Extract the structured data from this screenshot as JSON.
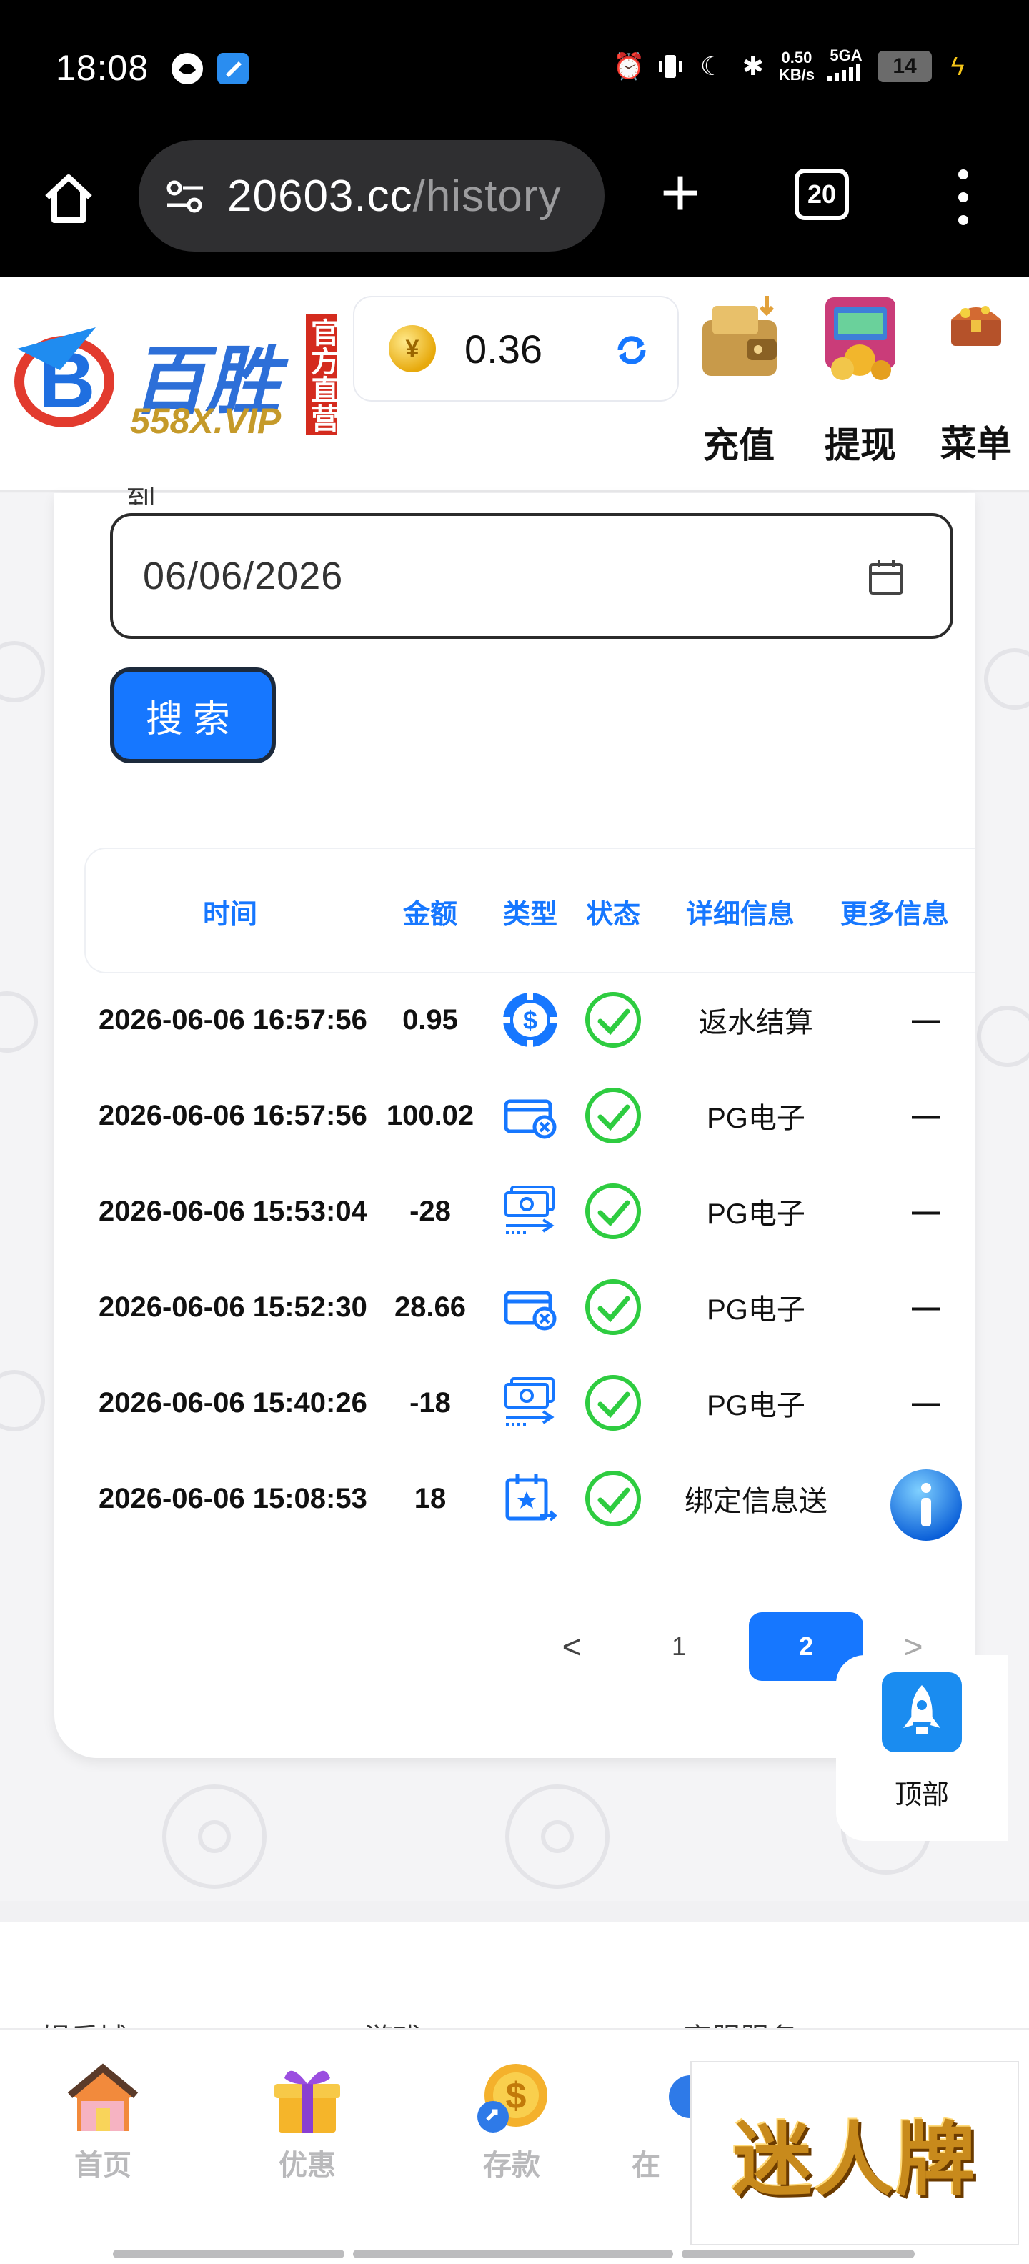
{
  "status_bar": {
    "time": "18:08",
    "net_speed_value": "0.50",
    "net_speed_unit": "KB/s",
    "network": "5GA",
    "battery": "14",
    "icons": [
      "alarm-icon",
      "vibrate-icon",
      "moon-icon",
      "bluetooth-icon",
      "signal-icon",
      "battery-icon",
      "charging-icon"
    ]
  },
  "browser": {
    "url_host": "20603.cc",
    "url_path": "/history",
    "tab_count": "20"
  },
  "header": {
    "logo_text": "百胜",
    "logo_sub": "558X.VIP",
    "logo_badge": "官方直营",
    "balance": "0.36",
    "buttons": [
      {
        "label": "充值",
        "icon": "wallet-icon"
      },
      {
        "label": "提现",
        "icon": "atm-icon"
      },
      {
        "label": "菜单",
        "icon": "treasure-chest-icon"
      }
    ]
  },
  "filter": {
    "to_label": "到",
    "to_date": "06/06/2026",
    "search_label": "搜索"
  },
  "table": {
    "headers": [
      "时间",
      "金额",
      "类型",
      "状态",
      "详细信息",
      "更多信息"
    ],
    "rows": [
      {
        "time": "2026-06-06 16:57:56",
        "amount": "0.95",
        "type_icon": "rebate-chip-icon",
        "status_icon": "check-icon",
        "detail": "返水结算",
        "more": "—"
      },
      {
        "time": "2026-06-06 16:57:56",
        "amount": "100.02",
        "type_icon": "card-withdraw-icon",
        "status_icon": "check-icon",
        "detail": "PG电子",
        "more": "—"
      },
      {
        "time": "2026-06-06 15:53:04",
        "amount": "-28",
        "type_icon": "cash-transfer-icon",
        "status_icon": "check-icon",
        "detail": "PG电子",
        "more": "—"
      },
      {
        "time": "2026-06-06 15:52:30",
        "amount": "28.66",
        "type_icon": "card-withdraw-icon",
        "status_icon": "check-icon",
        "detail": "PG电子",
        "more": "—"
      },
      {
        "time": "2026-06-06 15:40:26",
        "amount": "-18",
        "type_icon": "cash-transfer-icon",
        "status_icon": "check-icon",
        "detail": "PG电子",
        "more": "—"
      },
      {
        "time": "2026-06-06 15:08:53",
        "amount": "18",
        "type_icon": "calendar-bonus-icon",
        "status_icon": "check-icon",
        "detail": "绑定信息送",
        "more": "info-icon"
      }
    ]
  },
  "pagination": {
    "prev": "<",
    "pages": [
      "1",
      "2"
    ],
    "current": "2",
    "next": ">"
  },
  "to_top": {
    "label": "顶部"
  },
  "footer": {
    "captions": [
      "娱乐城",
      "游戏",
      "客服服务"
    ]
  },
  "bottom_nav": [
    {
      "label": "首页",
      "icon": "house-icon"
    },
    {
      "label": "优惠",
      "icon": "gift-icon"
    },
    {
      "label": "存款",
      "icon": "coin-deposit-icon"
    },
    {
      "label": "在",
      "icon": "online-icon"
    }
  ],
  "ad": {
    "text": "迷人牌"
  },
  "colors": {
    "accent": "#1677ff",
    "success": "#2ecc40",
    "header_black": "#000000"
  }
}
